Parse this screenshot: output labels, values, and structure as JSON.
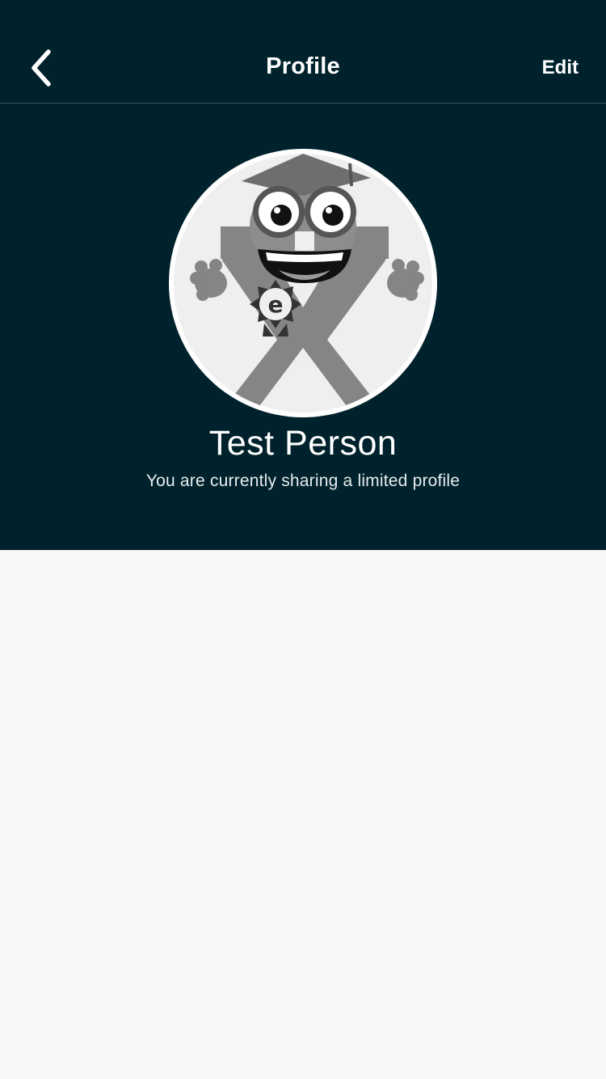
{
  "nav": {
    "title": "Profile",
    "edit_label": "Edit",
    "back_icon": "chevron-left-icon"
  },
  "profile": {
    "name": "Test Person",
    "subtitle": "You are currently sharing a limited profile",
    "avatar_icon": "mascot-avatar-icon"
  },
  "colors": {
    "header_background": "#00222c",
    "page_background": "#f9f8f6",
    "text_primary": "#ffffff"
  }
}
